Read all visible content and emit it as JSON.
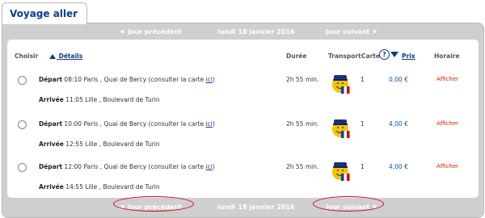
{
  "tab": {
    "label": "Voyage aller"
  },
  "nav": {
    "prev_label": "Jour précédent",
    "date": "lundi 18 janvier 2016",
    "next_label": "Jour suivant"
  },
  "columns": {
    "choisir": "Choisir",
    "details": "Détails",
    "duree": "Durée",
    "transport": "Transport",
    "carte": "Carte",
    "help": "?",
    "prix": "Prix",
    "horaire": "Horaire"
  },
  "trips": [
    {
      "depart_label": "Départ",
      "depart_time": "08:10",
      "depart_place": "Paris , Quai de Bercy (consulter la carte",
      "carte_link": "ici",
      "arrivee_label": "Arrivée",
      "arrivee_time": "11:05",
      "arrivee_place": "Lille , Boulevard de Turin",
      "duree": "2h 55 min.",
      "carte": "1",
      "prix": "0,00 €",
      "horaire": "Afficher"
    },
    {
      "depart_label": "Départ",
      "depart_time": "10:00",
      "depart_place": "Paris , Quai de Bercy (consulter la carte",
      "carte_link": "ici",
      "arrivee_label": "Arrivée",
      "arrivee_time": "12:55",
      "arrivee_place": "Lille , Boulevard de Turin",
      "duree": "2h 55 min.",
      "carte": "1",
      "prix": "4,00 €",
      "horaire": "Afficher"
    },
    {
      "depart_label": "Départ",
      "depart_time": "12:00",
      "depart_place": "Paris , Quai de Bercy (consulter la carte",
      "carte_link": "ici",
      "arrivee_label": "Arrivée",
      "arrivee_time": "14:55",
      "arrivee_place": "Lille , Boulevard de Turin",
      "duree": "2h 55 min.",
      "carte": "1",
      "prix": "4,00 €",
      "horaire": "Afficher"
    }
  ],
  "colors": {
    "brand_blue": "#0f3a8c",
    "price_blue": "#0f4fa8",
    "action_red": "#cc2200",
    "highlight_red": "#d0021b",
    "panel_gray": "#cfcfcf"
  },
  "icons": {
    "transport": "bus-driver-mascot-icon",
    "prev": "triangle-left-icon",
    "next": "triangle-right-icon",
    "sort_up": "sort-up-icon",
    "sort_down": "sort-down-icon",
    "help": "help-icon"
  }
}
